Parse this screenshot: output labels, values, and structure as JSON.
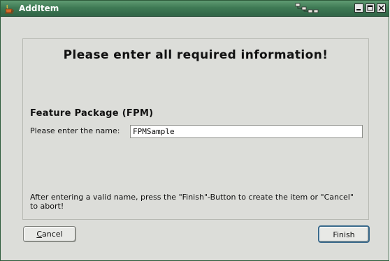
{
  "window": {
    "title": "AddItem",
    "app_icon": "java-cup-icon",
    "status_icon": "network-icon",
    "controls": [
      "minimize-icon",
      "maximize-icon",
      "close-icon"
    ],
    "title_color": "#3f7a55"
  },
  "dialog": {
    "heading": "Please enter all required information!",
    "section_title": "Feature Package (FPM)",
    "name_label": "Please enter the name:",
    "name_value": "FPMSample",
    "hint": "After entering a valid name, press the \"Finish\"-Button to create the item or \"Cancel\" to abort!"
  },
  "buttons": {
    "cancel_label": "Cancel",
    "finish_label": "Finish"
  }
}
